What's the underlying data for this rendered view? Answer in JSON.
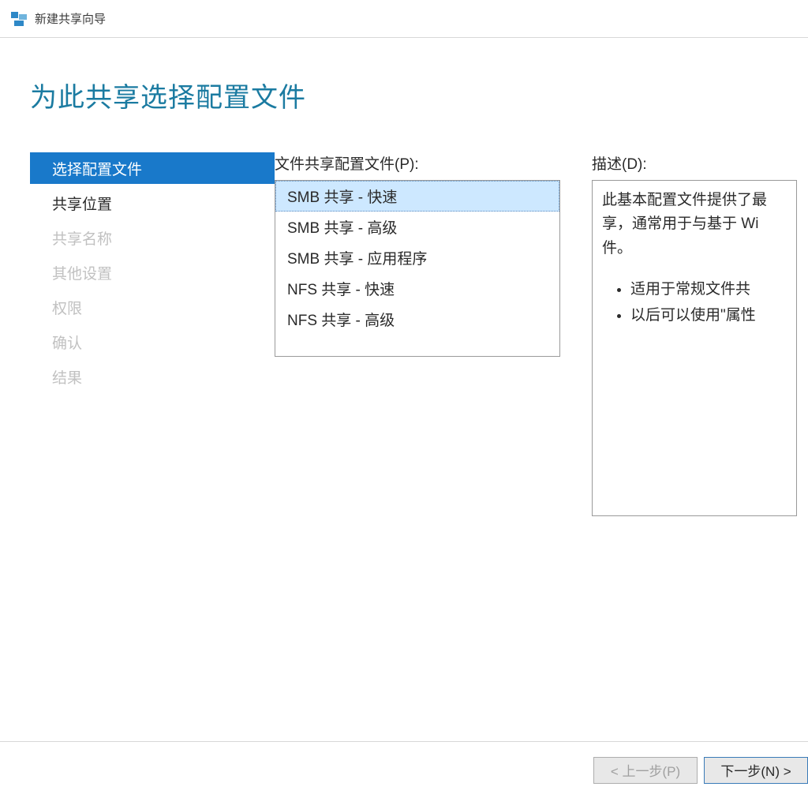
{
  "window": {
    "title": "新建共享向导"
  },
  "heading": "为此共享选择配置文件",
  "sidebar": {
    "items": [
      {
        "label": "选择配置文件",
        "active": true,
        "disabled": false
      },
      {
        "label": "共享位置",
        "active": false,
        "disabled": false
      },
      {
        "label": "共享名称",
        "active": false,
        "disabled": true
      },
      {
        "label": "其他设置",
        "active": false,
        "disabled": true
      },
      {
        "label": "权限",
        "active": false,
        "disabled": true
      },
      {
        "label": "确认",
        "active": false,
        "disabled": true
      },
      {
        "label": "结果",
        "active": false,
        "disabled": true
      }
    ]
  },
  "profiles": {
    "label": "文件共享配置文件(P):",
    "items": [
      {
        "label": "SMB 共享 - 快速",
        "selected": true
      },
      {
        "label": "SMB 共享 - 高级",
        "selected": false
      },
      {
        "label": "SMB 共享 - 应用程序",
        "selected": false
      },
      {
        "label": "NFS 共享 - 快速",
        "selected": false
      },
      {
        "label": "NFS 共享 - 高级",
        "selected": false
      }
    ]
  },
  "description": {
    "label": "描述(D):",
    "paragraph": "此基本配置文件提供了最享，通常用于与基于 Wi件。",
    "bullets": [
      "适用于常规文件共",
      "以后可以使用\"属性"
    ]
  },
  "footer": {
    "prev": "< 上一步(P)",
    "next": "下一步(N) >"
  }
}
